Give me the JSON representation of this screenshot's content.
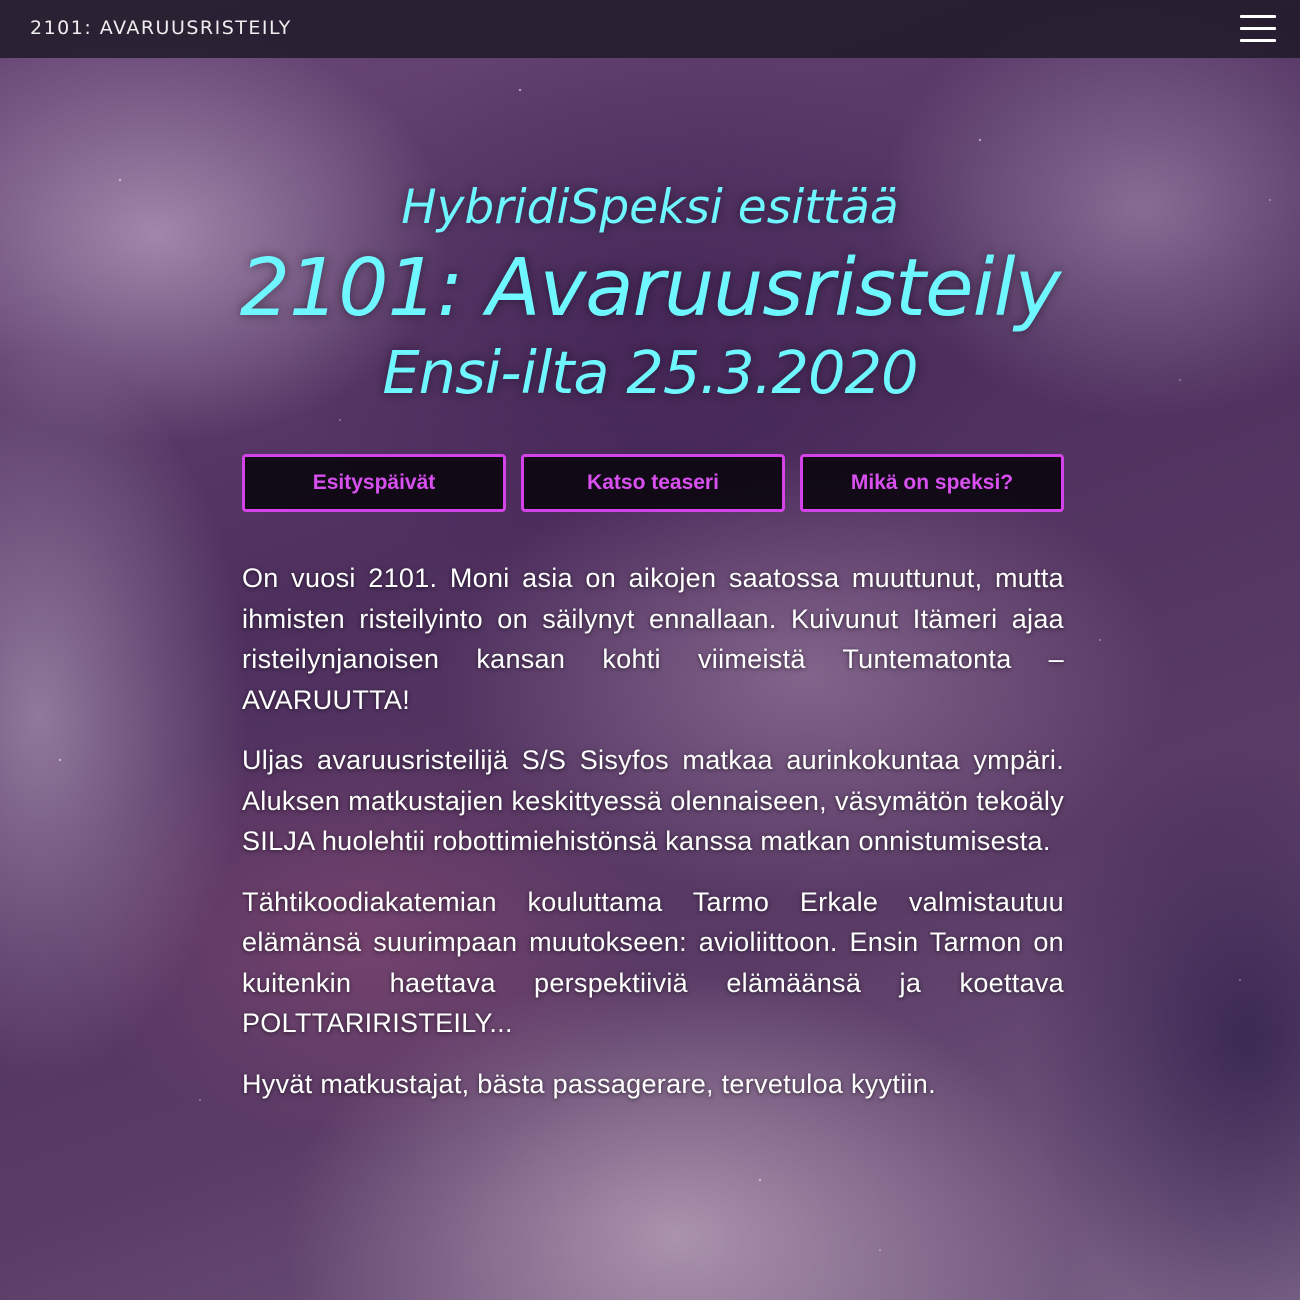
{
  "header": {
    "brand": "2101: AVARUUSRISTEILY",
    "menu_icon": "hamburger-menu-icon"
  },
  "hero": {
    "presenter": "HybridiSpeksi esittää",
    "title": "2101: Avaruusristeily",
    "premiere": "Ensi-ilta 25.3.2020"
  },
  "buttons": [
    {
      "label": "Esityspäivät"
    },
    {
      "label": "Katso teaseri"
    },
    {
      "label": "Mikä on speksi?"
    }
  ],
  "story": {
    "paragraphs": [
      "On vuosi 2101. Moni asia on aikojen saatossa muuttunut, mutta ihmisten risteilyinto on säilynyt ennallaan. Kuivunut Itämeri ajaa risteilynjanoisen kansan kohti viimeistä Tuntematonta – AVARUUTTA!",
      "Uljas avaruusristeilijä S/S Sisyfos matkaa aurinkokuntaa ympäri. Aluksen matkustajien keskittyessä olennaiseen, väsymätön tekoäly SILJA huolehtii robottimiehistönsä kanssa matkan onnistumisesta.",
      "Tähtikoodiakatemian kouluttama Tarmo Erkale valmistautuu elämänsä suurimpaan muutokseen: avioliittoon. Ensin Tarmon on kuitenkin haettava perspektiiviä elämäänsä ja koettava POLTTARIRISTEILY...",
      "Hyvät matkustajat, bästa passagerare, tervetuloa kyytiin."
    ]
  },
  "colors": {
    "hero_text": "#6ff7ff",
    "button_accent": "#d443e8",
    "header_bg": "#1c1824"
  }
}
